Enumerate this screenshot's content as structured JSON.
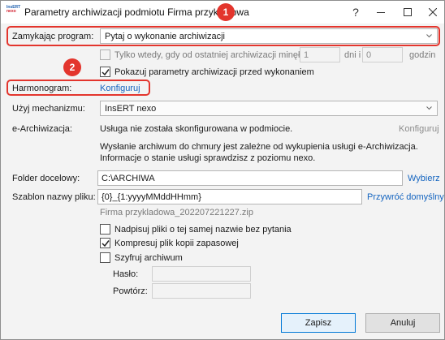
{
  "window": {
    "title": "Parametry archiwizacji podmiotu Firma przykładowa",
    "help_glyph": "?",
    "app_icon_lines": [
      "InsERT",
      "nexo"
    ]
  },
  "markers": {
    "m1": "1",
    "m2": "2"
  },
  "program": {
    "label": "Zamykając program:",
    "value": "Pytaj o wykonanie archiwizacji"
  },
  "only_when": {
    "label": "Tylko wtedy, gdy od ostatniej archiwizacji minęło:",
    "days_value": "1",
    "days_unit": "dni i",
    "hours_value": "0",
    "hours_unit": "godzin",
    "checked": false
  },
  "show_params": {
    "label": "Pokazuj parametry archiwizacji przed wykonaniem",
    "checked": true
  },
  "schedule": {
    "label": "Harmonogram:",
    "link": "Konfiguruj"
  },
  "mechanism": {
    "label": "Użyj mechanizmu:",
    "value": "InsERT nexo"
  },
  "earchive": {
    "label": "e-Archiwizacja:",
    "status": "Usługa nie została skonfigurowana w podmiocie.",
    "link": "Konfiguruj",
    "info_line1": "Wysłanie archiwum do chmury jest zależne od wykupienia usługi e-Archiwizacja.",
    "info_line2": "Informacje o stanie usługi sprawdzisz z poziomu nexo."
  },
  "folder": {
    "label": "Folder docelowy:",
    "value": "C:\\ARCHIWA",
    "link": "Wybierz"
  },
  "filename": {
    "label": "Szablon nazwy pliku:",
    "value": "{0}_{1:yyyyMMddHHmm}",
    "link": "Przywróć domyślny",
    "preview": "Firma przykladowa_202207221227.zip"
  },
  "options": {
    "overwrite": {
      "label": "Nadpisuj pliki o tej samej nazwie bez pytania",
      "checked": false
    },
    "compress": {
      "label": "Kompresuj plik kopii zapasowej",
      "checked": true
    },
    "encrypt": {
      "label": "Szyfruj archiwum",
      "checked": false
    }
  },
  "password": {
    "label": "Hasło:",
    "repeat_label": "Powtórz:",
    "value": "",
    "repeat_value": ""
  },
  "buttons": {
    "save": "Zapisz",
    "cancel": "Anuluj"
  },
  "colors": {
    "accent_link": "#1565c0",
    "marker": "#e3352d",
    "primary_button_border": "#0078d7"
  }
}
